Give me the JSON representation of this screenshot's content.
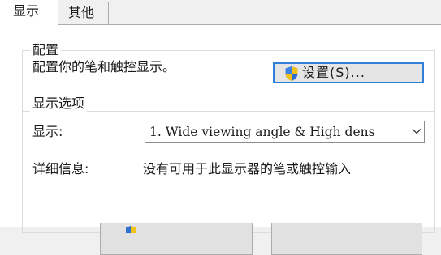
{
  "tabs": [
    {
      "label": "显示",
      "active": true
    },
    {
      "label": "其他",
      "active": false
    }
  ],
  "config_group": {
    "title": "配置",
    "description": "配置你的笔和触控显示。",
    "settings_button": "设置(S)..."
  },
  "display_group": {
    "title": "显示选项",
    "display_label": "显示:",
    "display_selected": "1. Wide viewing angle & High dens",
    "details_label": "详细信息:",
    "details_value": "没有可用于此显示器的笔或触控输入"
  },
  "icons": {
    "settings_button_icon": "uac-shield-icon",
    "dropdown_icon": "chevron-down-icon"
  },
  "colors": {
    "window_bg": "#f0f0f0",
    "panel_bg": "#ffffff",
    "focus_border": "#2e7fd6",
    "shield_blue": "#2f6fd0",
    "shield_yellow": "#f2c21b"
  }
}
